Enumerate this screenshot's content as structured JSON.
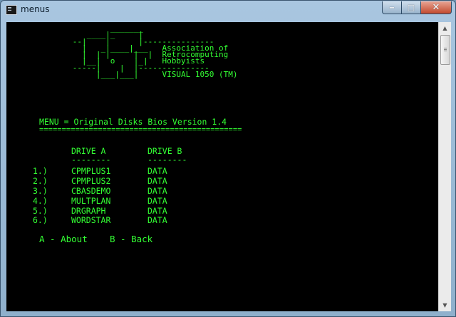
{
  "window": {
    "title": "menus",
    "icon": "console-window-icon"
  },
  "caption_buttons": {
    "minimize": "‒",
    "maximize": "□",
    "close": "✕"
  },
  "logo_art": "                      _______\n                 ____|_     |\n              --|    |      |---------------\n                |   _|____|___   Association of\n                |  | |     |  |  Retrocomputing\n                |__|  o    |_|   Hobbyists\n              -----|    |  |---------------\n                   |___|___|     VISUAL 1050 (TM)",
  "menu": {
    "title": "MENU = Original Disks Bios Version 1.4",
    "rule": "=============================================",
    "col_a": "DRIVE A",
    "col_b": "DRIVE B",
    "col_a_rule": "--------",
    "col_b_rule": "--------",
    "items": [
      {
        "num": "1.)",
        "a": "CPMPLUS1",
        "b": "DATA"
      },
      {
        "num": "2.)",
        "a": "CPMPLUS2",
        "b": "DATA"
      },
      {
        "num": "3.)",
        "a": "CBASDEMO",
        "b": "DATA"
      },
      {
        "num": "4.)",
        "a": "MULTPLAN",
        "b": "DATA"
      },
      {
        "num": "5.)",
        "a": "DRGRAPH",
        "b": "DATA"
      },
      {
        "num": "6.)",
        "a": "WORDSTAR",
        "b": "DATA"
      }
    ],
    "option_about": "A - About",
    "option_back": "B - Back"
  },
  "scrollbar": {
    "up_icon": "arrow-up-icon",
    "down_icon": "arrow-down-icon"
  },
  "colors": {
    "terminal_text": "#33ff33",
    "terminal_bg": "#000000"
  }
}
